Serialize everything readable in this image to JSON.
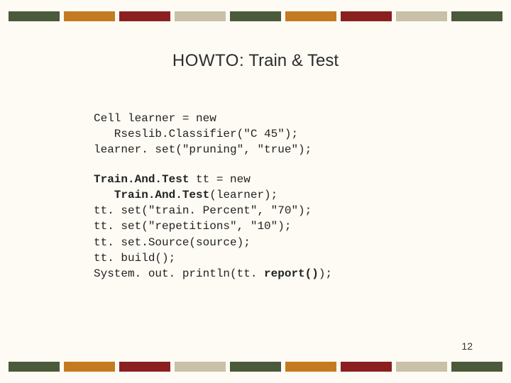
{
  "title": {
    "prefix": "HOWTO:",
    "rest": "  Train & Test"
  },
  "code": {
    "l1": "Cell learner = new",
    "l2": "   Rseslib.Classifier(\"C 45\");",
    "l3": "learner. set(\"pruning\", \"true\");",
    "l4a": "Train.And.Test",
    "l4b": " tt = new",
    "l5a": "   ",
    "l5b": "Train.And.Test",
    "l5c": "(learner);",
    "l6": "tt. set(\"train. Percent\", \"70\");",
    "l7": "tt. set(\"repetitions\", \"10\");",
    "l8": "tt. set.Source(source);",
    "l9": "tt. build();",
    "l10a": "System. out. println(tt. ",
    "l10b": "report()",
    "l10c": ");"
  },
  "pagenum": "12"
}
